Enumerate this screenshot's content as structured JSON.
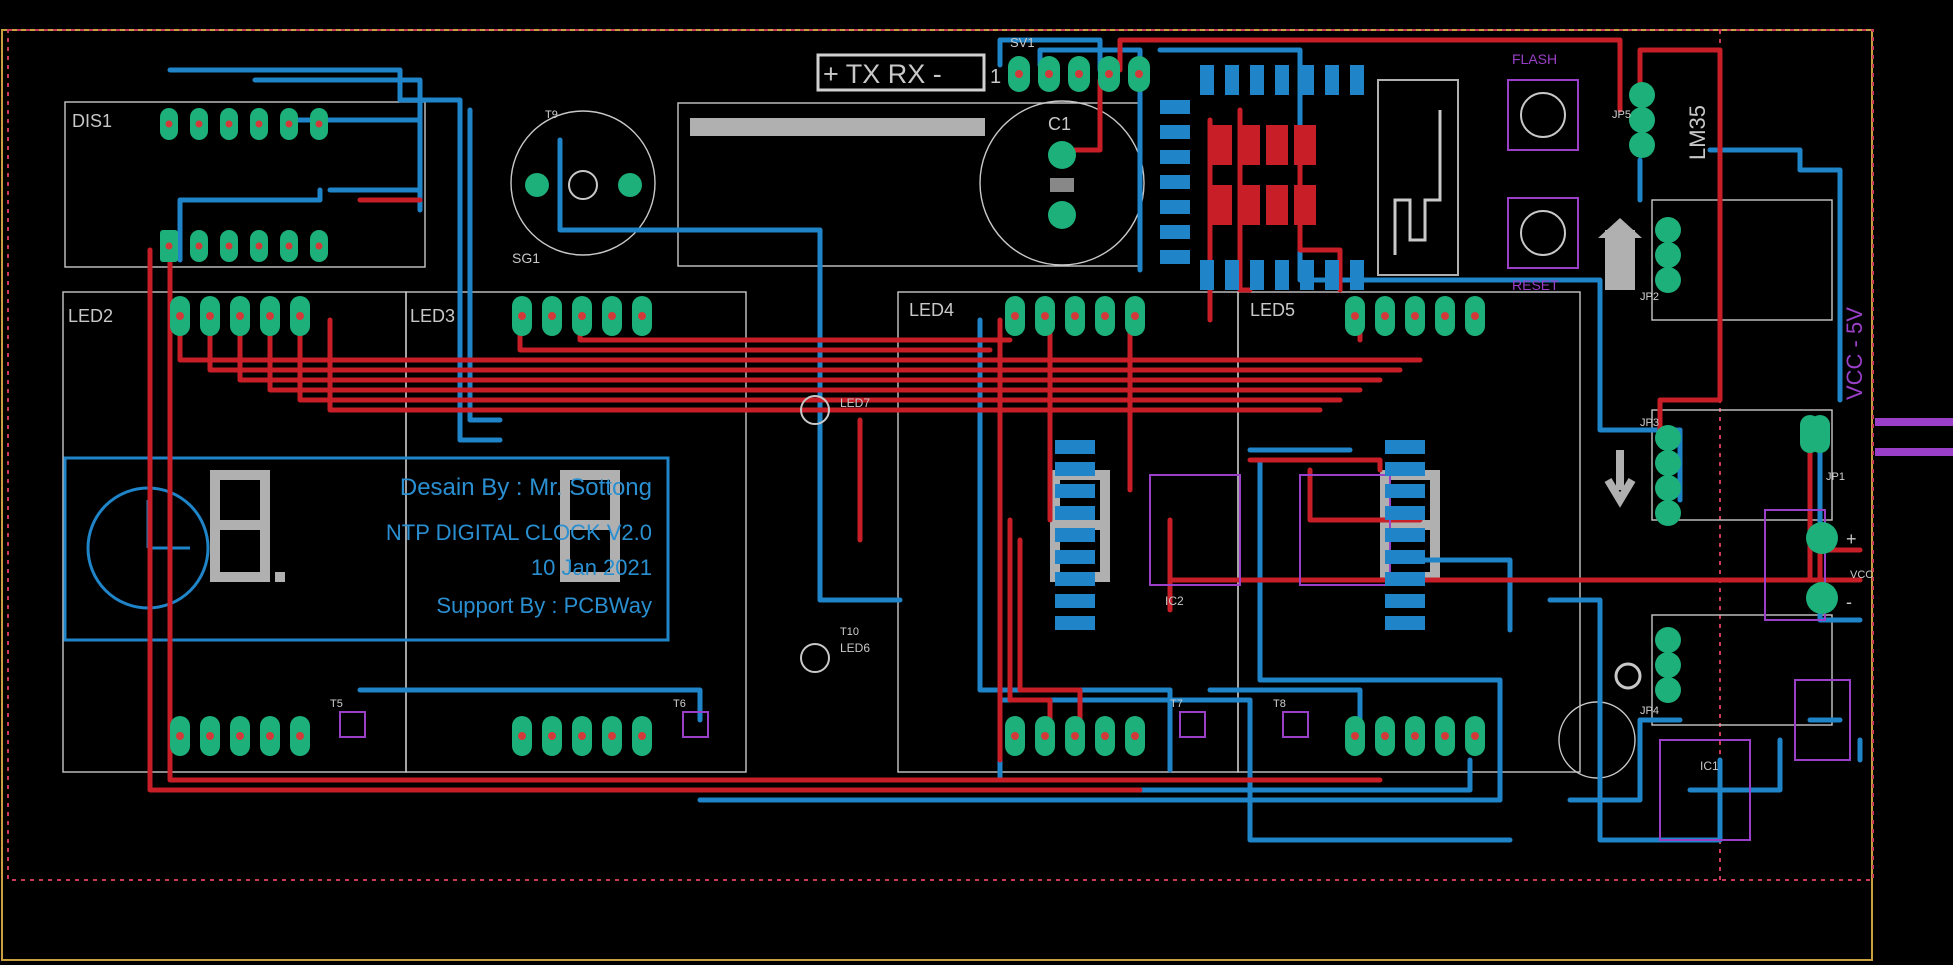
{
  "board": {
    "header_label": "+ TX RX -",
    "pin_one": "1",
    "connector_sv1": "SV1",
    "cap_c1": "C1",
    "dis1": "DIS1",
    "buzzer": "SG1",
    "flash": "FLASH",
    "reset": "RESET",
    "sensor": "LM35",
    "vcc_text": "VCC - 5V",
    "vcc_pin_label": "VCC",
    "jp_labels": [
      "JP5",
      "JP2",
      "JP3",
      "JP4",
      "JP1"
    ],
    "led_labels": [
      "LED2",
      "LED3",
      "LED4",
      "LED5"
    ],
    "ic_labels": [
      "IC1",
      "IC2"
    ],
    "small_led_labels": [
      "LED7",
      "LED6"
    ],
    "transistor_labels": [
      "T5",
      "T6",
      "T7",
      "T8",
      "T9",
      "T10"
    ],
    "silk_text": {
      "line1": "Desain By : Mr. Sottong",
      "line2": "NTP DIGITAL CLOCK V2.0",
      "line3": "10 Jan 2021",
      "line4": "Support By : PCBWay"
    },
    "colors": {
      "top_copper": "#c81e28",
      "bottom_copper": "#1f84c8",
      "pads": "#1db07a",
      "silkscreen": "#c8c8c8",
      "board_edge": "#c8a040",
      "ic_outline": "#9a3fc8"
    }
  }
}
